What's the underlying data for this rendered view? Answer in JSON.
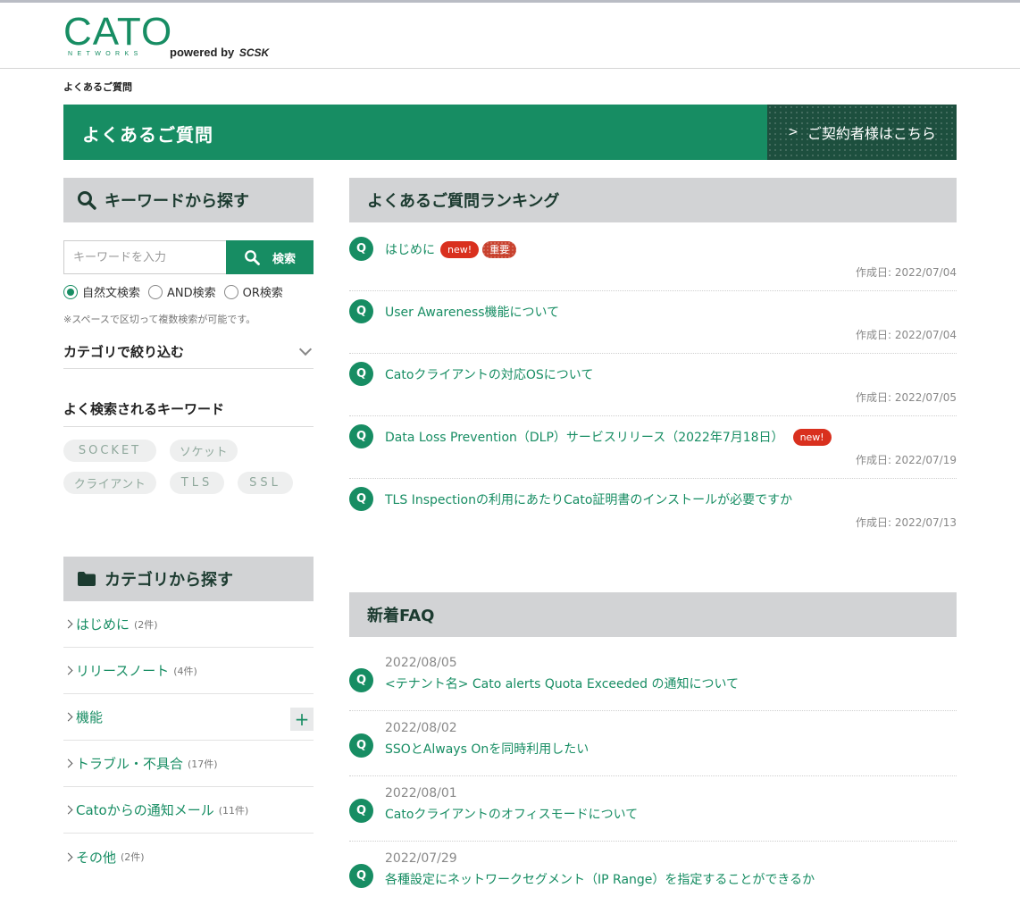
{
  "brand": {
    "name": "CATO",
    "sub": "NETWORKS",
    "powered": "powered by",
    "partner": "SCSK"
  },
  "breadcrumb": "よくあるご質問",
  "hero": {
    "title": "よくあるご質問",
    "contract_button": "ご契約者様はこちら"
  },
  "keyword_search": {
    "heading": "キーワードから探す",
    "placeholder": "キーワードを入力",
    "button": "検索",
    "modes": [
      "自然文検索",
      "AND検索",
      "OR検索"
    ],
    "selected_mode": "自然文検索",
    "note": "※スペースで区切って複数検索が可能です。",
    "filter_label": "カテゴリで絞り込む",
    "popular_heading": "よく検索されるキーワード",
    "popular_tags": [
      "SOCKET",
      "ソケット",
      "クライアント",
      "TLS",
      "SSL"
    ]
  },
  "categories": {
    "heading": "カテゴリから探す",
    "items": [
      {
        "label": "はじめに",
        "count": "(2件)"
      },
      {
        "label": "リリースノート",
        "count": "(4件)"
      },
      {
        "label": "機能",
        "count": "",
        "expandable": "+"
      },
      {
        "label": "トラブル・不具合",
        "count": "(17件)"
      },
      {
        "label": "Catoからの通知メール",
        "count": "(11件)"
      },
      {
        "label": "その他",
        "count": "(2件)"
      }
    ]
  },
  "ranking": {
    "heading": "よくあるご質問ランキング",
    "q_mark": "Q",
    "items": [
      {
        "title": "はじめに",
        "badges": [
          "new!",
          "重要"
        ],
        "date": "作成日: 2022/07/04"
      },
      {
        "title": "User Awareness機能について",
        "badges": [],
        "date": "作成日: 2022/07/04"
      },
      {
        "title": "Catoクライアントの対応OSについて",
        "badges": [],
        "date": "作成日: 2022/07/05"
      },
      {
        "title": "Data Loss Prevention（DLP）サービスリリース（2022年7月18日）",
        "badges": [
          "new!"
        ],
        "date": "作成日: 2022/07/19"
      },
      {
        "title": "TLS Inspectionの利用にあたりCato証明書のインストールが必要ですか",
        "badges": [],
        "date": "作成日: 2022/07/13"
      }
    ]
  },
  "new_faq": {
    "heading": "新着FAQ",
    "items": [
      {
        "date": "2022/08/05",
        "title": "<テナント名> Cato alerts Quota Exceeded の通知について"
      },
      {
        "date": "2022/08/02",
        "title": "SSOとAlways Onを同時利用したい"
      },
      {
        "date": "2022/08/01",
        "title": "Catoクライアントのオフィスモードについて"
      },
      {
        "date": "2022/07/29",
        "title": "各種設定にネットワークセグメント（IP Range）を指定することができるか"
      }
    ]
  },
  "colors": {
    "brand_green": "#178d63",
    "dark_green": "#1d4f3e",
    "badge_red": "#d9301e",
    "header_gray": "#d2d3d5"
  }
}
